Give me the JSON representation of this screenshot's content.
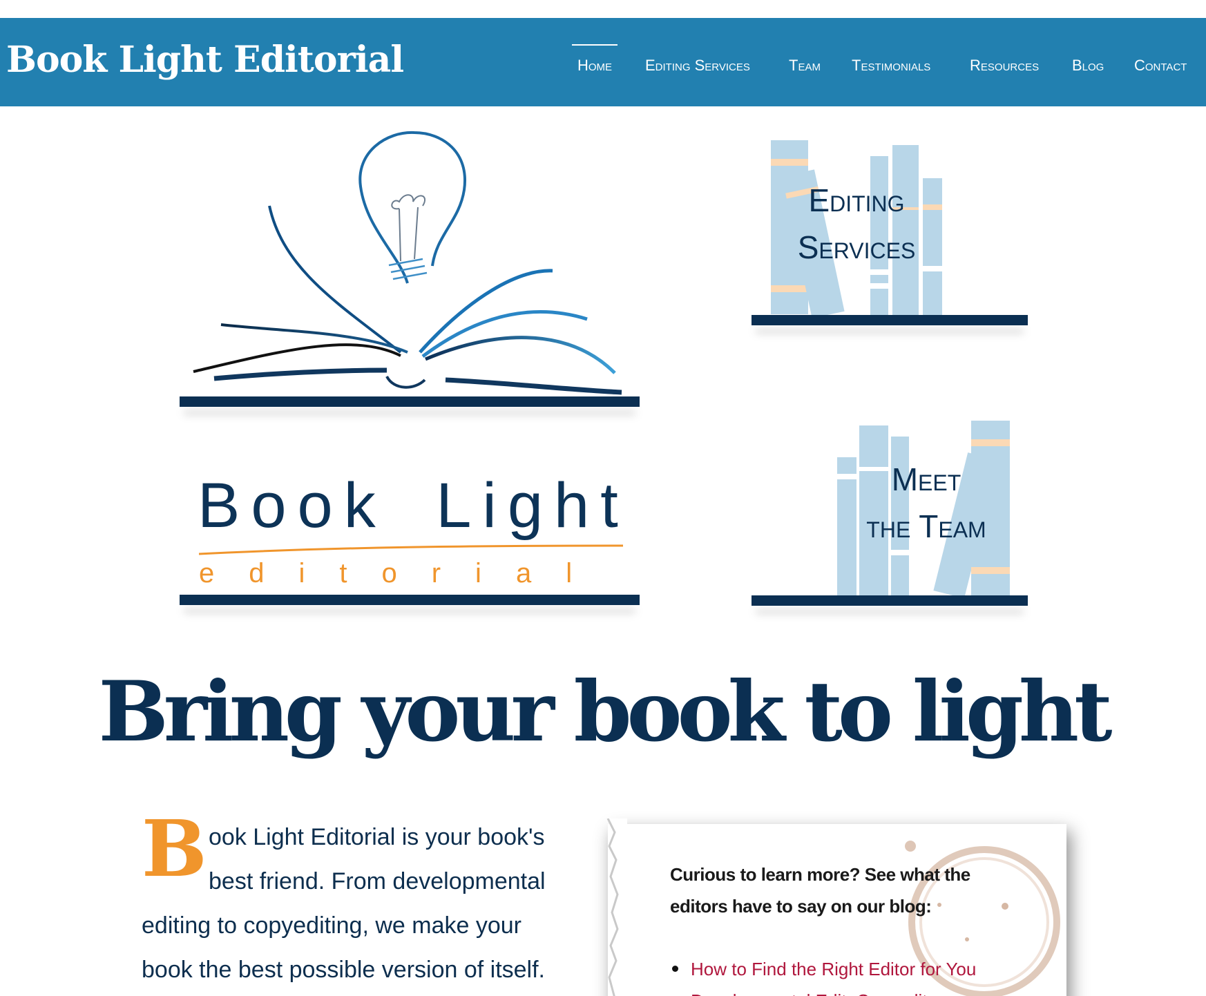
{
  "header": {
    "site_title": "Book Light Editorial",
    "nav": [
      {
        "label": "Home",
        "active": true
      },
      {
        "label": "Editing Services",
        "active": false
      },
      {
        "label": "Team",
        "active": false
      },
      {
        "label": "Testimonials",
        "active": false
      },
      {
        "label": "Resources",
        "active": false
      },
      {
        "label": "Blog",
        "active": false
      },
      {
        "label": "Contact",
        "active": false
      }
    ]
  },
  "brand_logo": {
    "word": "Book Light",
    "sub": "editorial"
  },
  "tiles": {
    "editing_services": {
      "line1": "Editing",
      "line2": "Services"
    },
    "meet_team": {
      "line1": "Meet",
      "line2": "the Team"
    }
  },
  "headline": "Bring your book to light",
  "intro": {
    "dropcap": "B",
    "lines": [
      "ook Light Editorial is your book's",
      "best friend. From developmental",
      "editing to copyediting, we make your",
      "book the best possible version of itself."
    ]
  },
  "card": {
    "heading": "Curious to learn more? See what the editors have to say on our blog:",
    "links": [
      "How to Find the Right Editor for You",
      "Developmental Edit, Copyedit, or"
    ]
  },
  "colors": {
    "header_bg": "#2280b0",
    "navy": "#0b2f52",
    "orange": "#f0952c",
    "link": "#b0173d",
    "book_blue": "#b8d6e8",
    "book_peach": "#fbd9b5"
  }
}
